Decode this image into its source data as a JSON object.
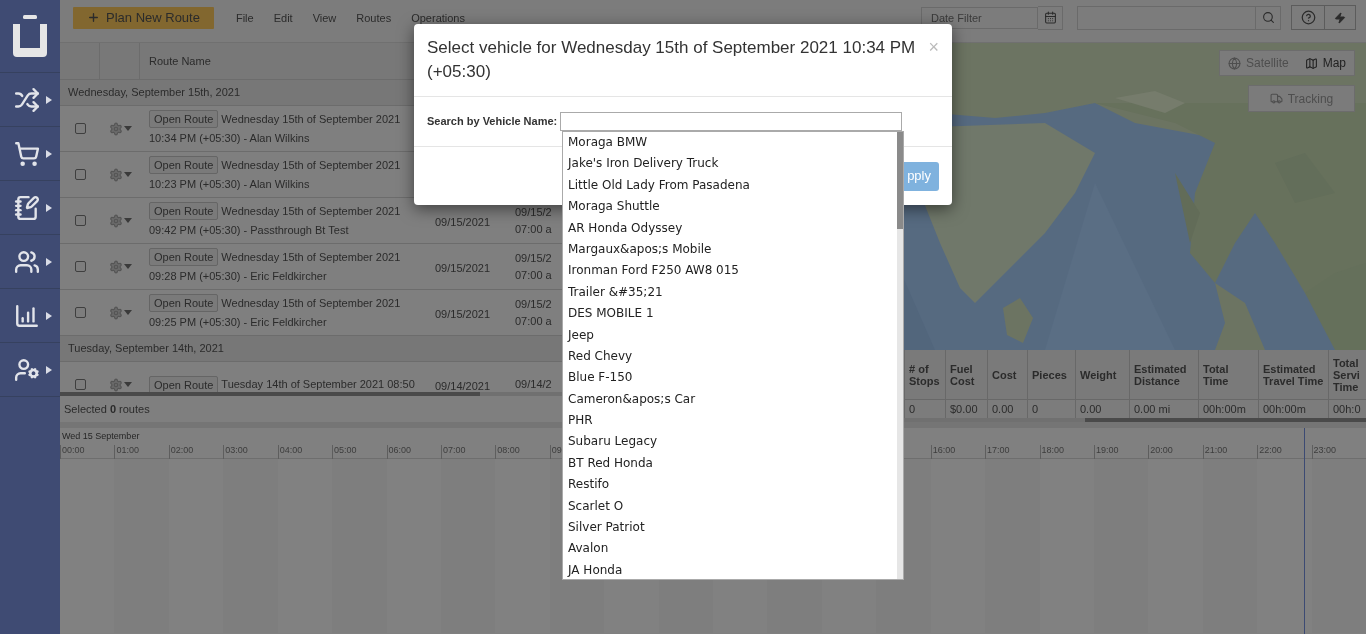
{
  "toolbar": {
    "plan_button": "Plan New Route",
    "menu": [
      "File",
      "Edit",
      "View",
      "Routes",
      "Operations"
    ],
    "date_filter": {
      "placeholder": "Date Filter"
    }
  },
  "routes_table": {
    "columns": [
      "Route Name"
    ],
    "groups": [
      {
        "label": "Wednesday, September 15th, 2021",
        "rows": [
          {
            "checked": false,
            "open_button": "Open Route",
            "title": "Wednesday 15th of September 2021",
            "subtitle": "10:34 PM (+05:30) - Alan Wilkins"
          },
          {
            "checked": false,
            "open_button": "Open Route",
            "title": "Wednesday 15th of September 2021",
            "subtitle": "10:23 PM (+05:30) - Alan Wilkins"
          },
          {
            "checked": false,
            "open_button": "Open Route",
            "title": "Wednesday 15th of September 2021",
            "subtitle": "09:42 PM (+05:30) - Passthrough Bt Test",
            "date": "09/15/2021",
            "start_date": "09/15/2",
            "start_time": "07:00 a"
          },
          {
            "checked": false,
            "open_button": "Open Route",
            "title": "Wednesday 15th of September 2021",
            "subtitle": "09:28 PM (+05:30) - Eric Feldkircher",
            "date": "09/15/2021",
            "start_date": "09/15/2",
            "start_time": "07:00 a"
          },
          {
            "checked": false,
            "open_button": "Open Route",
            "title": "Wednesday 15th of September 2021",
            "subtitle": "09:25 PM (+05:30) - Eric Feldkircher",
            "date": "09/15/2021",
            "start_date": "09/15/2",
            "start_time": "07:00 a"
          }
        ]
      },
      {
        "label": "Tuesday, September 14th, 2021",
        "rows": [
          {
            "checked": false,
            "open_button": "Open Route",
            "title": "Tuesday 14th of September 2021 08:50",
            "date": "09/14/2021",
            "start_date": "09/14/2"
          }
        ]
      }
    ],
    "footer": "Selected **0** routes"
  },
  "map": {
    "buttons": [
      {
        "label": "Satellite",
        "selected": false
      },
      {
        "label": "Map",
        "selected": true
      }
    ],
    "tracking": "Tracking"
  },
  "stats_table": {
    "columns": [
      "# of Stops",
      "Fuel Cost",
      "Cost",
      "Pieces",
      "Weight",
      "Estimated Distance",
      "Total Time",
      "Estimated Travel Time",
      "Total Servi Time"
    ],
    "row": [
      "0",
      "$0.00",
      "0.00",
      "0",
      "0.00",
      "0.00 mi",
      "00h:00m",
      "00h:00m",
      "00h:0"
    ]
  },
  "timeline": {
    "date": "Wed 15 September",
    "ticks_start": [
      "00:00",
      "01:00",
      "02:00",
      "03:00",
      "04:00",
      "05:00",
      "06:00",
      "07:00",
      "08:00",
      "09"
    ],
    "ticks_end": [
      "16:00",
      "17:00",
      "18:00",
      "19:00",
      "20:00",
      "21:00",
      "22:00",
      "23:00"
    ]
  },
  "modal": {
    "title": "Select vehicle for Wednesday 15th of September 2021 10:34 PM (+05:30)",
    "close": "×",
    "search_label": "Search by Vehicle Name:",
    "apply": "pply",
    "vehicles": [
      "Moraga BMW",
      "Jake's Iron Delivery Truck",
      "Little Old Lady From Pasadena",
      "Moraga Shuttle",
      "AR Honda Odyssey",
      "Margaux&apos;s Mobile",
      "Ironman Ford F250 AW8 015",
      "Trailer &#35;21",
      "DES MOBILE 1",
      "Jeep",
      "Red Chevy",
      "Blue F-150",
      "Cameron&apos;s Car",
      "PHR",
      "Subaru Legacy",
      "BT Red Honda",
      "Restifo",
      "Scarlet O",
      "Silver Patriot",
      "Avalon",
      "JA Honda"
    ]
  }
}
